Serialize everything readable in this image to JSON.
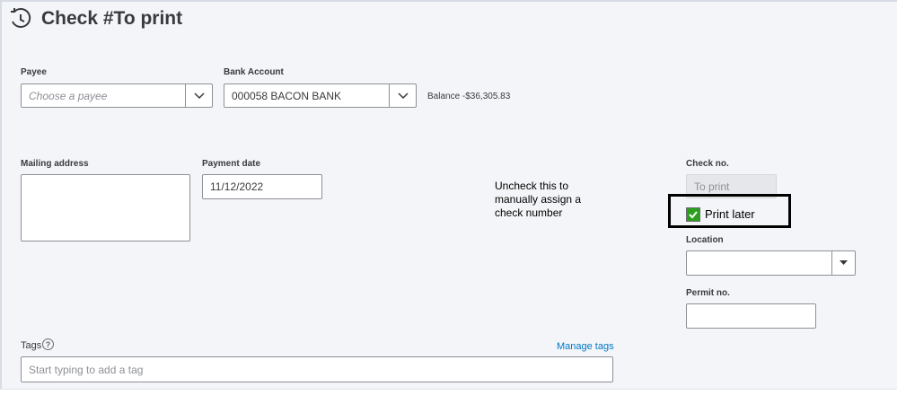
{
  "header": {
    "title": "Check #To print",
    "icon": "check-clock-icon"
  },
  "payee": {
    "label": "Payee",
    "placeholder": "Choose a payee",
    "value": ""
  },
  "bank_account": {
    "label": "Bank Account",
    "value": "000058 BACON BANK",
    "balance": "Balance -$36,305.83"
  },
  "mailing_address": {
    "label": "Mailing address",
    "value": ""
  },
  "payment_date": {
    "label": "Payment date",
    "value": "11/12/2022"
  },
  "annotation": {
    "text": "Uncheck this to manually assign a check number"
  },
  "check_no": {
    "label": "Check no.",
    "value": "To print"
  },
  "print_later": {
    "label": "Print later",
    "checked": true,
    "check_color": "#2ca01c"
  },
  "location": {
    "label": "Location",
    "value": ""
  },
  "permit": {
    "label": "Permit no.",
    "value": ""
  },
  "tags": {
    "label": "Tags",
    "help_icon": "?",
    "manage_label": "Manage tags",
    "placeholder": "Start typing to add a tag"
  }
}
